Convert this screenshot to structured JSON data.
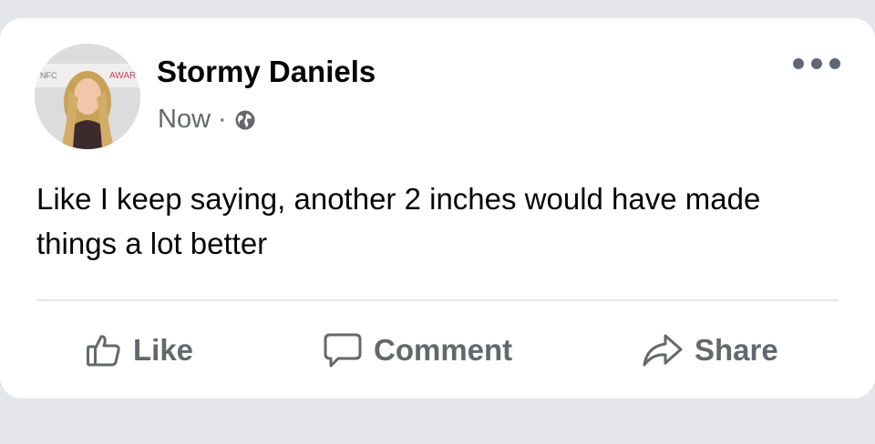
{
  "post": {
    "author": "Stormy Daniels",
    "timestamp": "Now",
    "separator": "·",
    "privacy_icon": "globe-icon",
    "text": "Like I keep saying, another 2 inches would have made things a lot better"
  },
  "actions": {
    "like": "Like",
    "comment": "Comment",
    "share": "Share"
  },
  "icons": {
    "more": "more-options-icon",
    "like": "thumbs-up-icon",
    "comment": "comment-bubble-icon",
    "share": "share-arrow-icon"
  },
  "colors": {
    "background": "#e4e6eb",
    "card": "#ffffff",
    "primary_text": "#050505",
    "secondary_text": "#65676b"
  }
}
